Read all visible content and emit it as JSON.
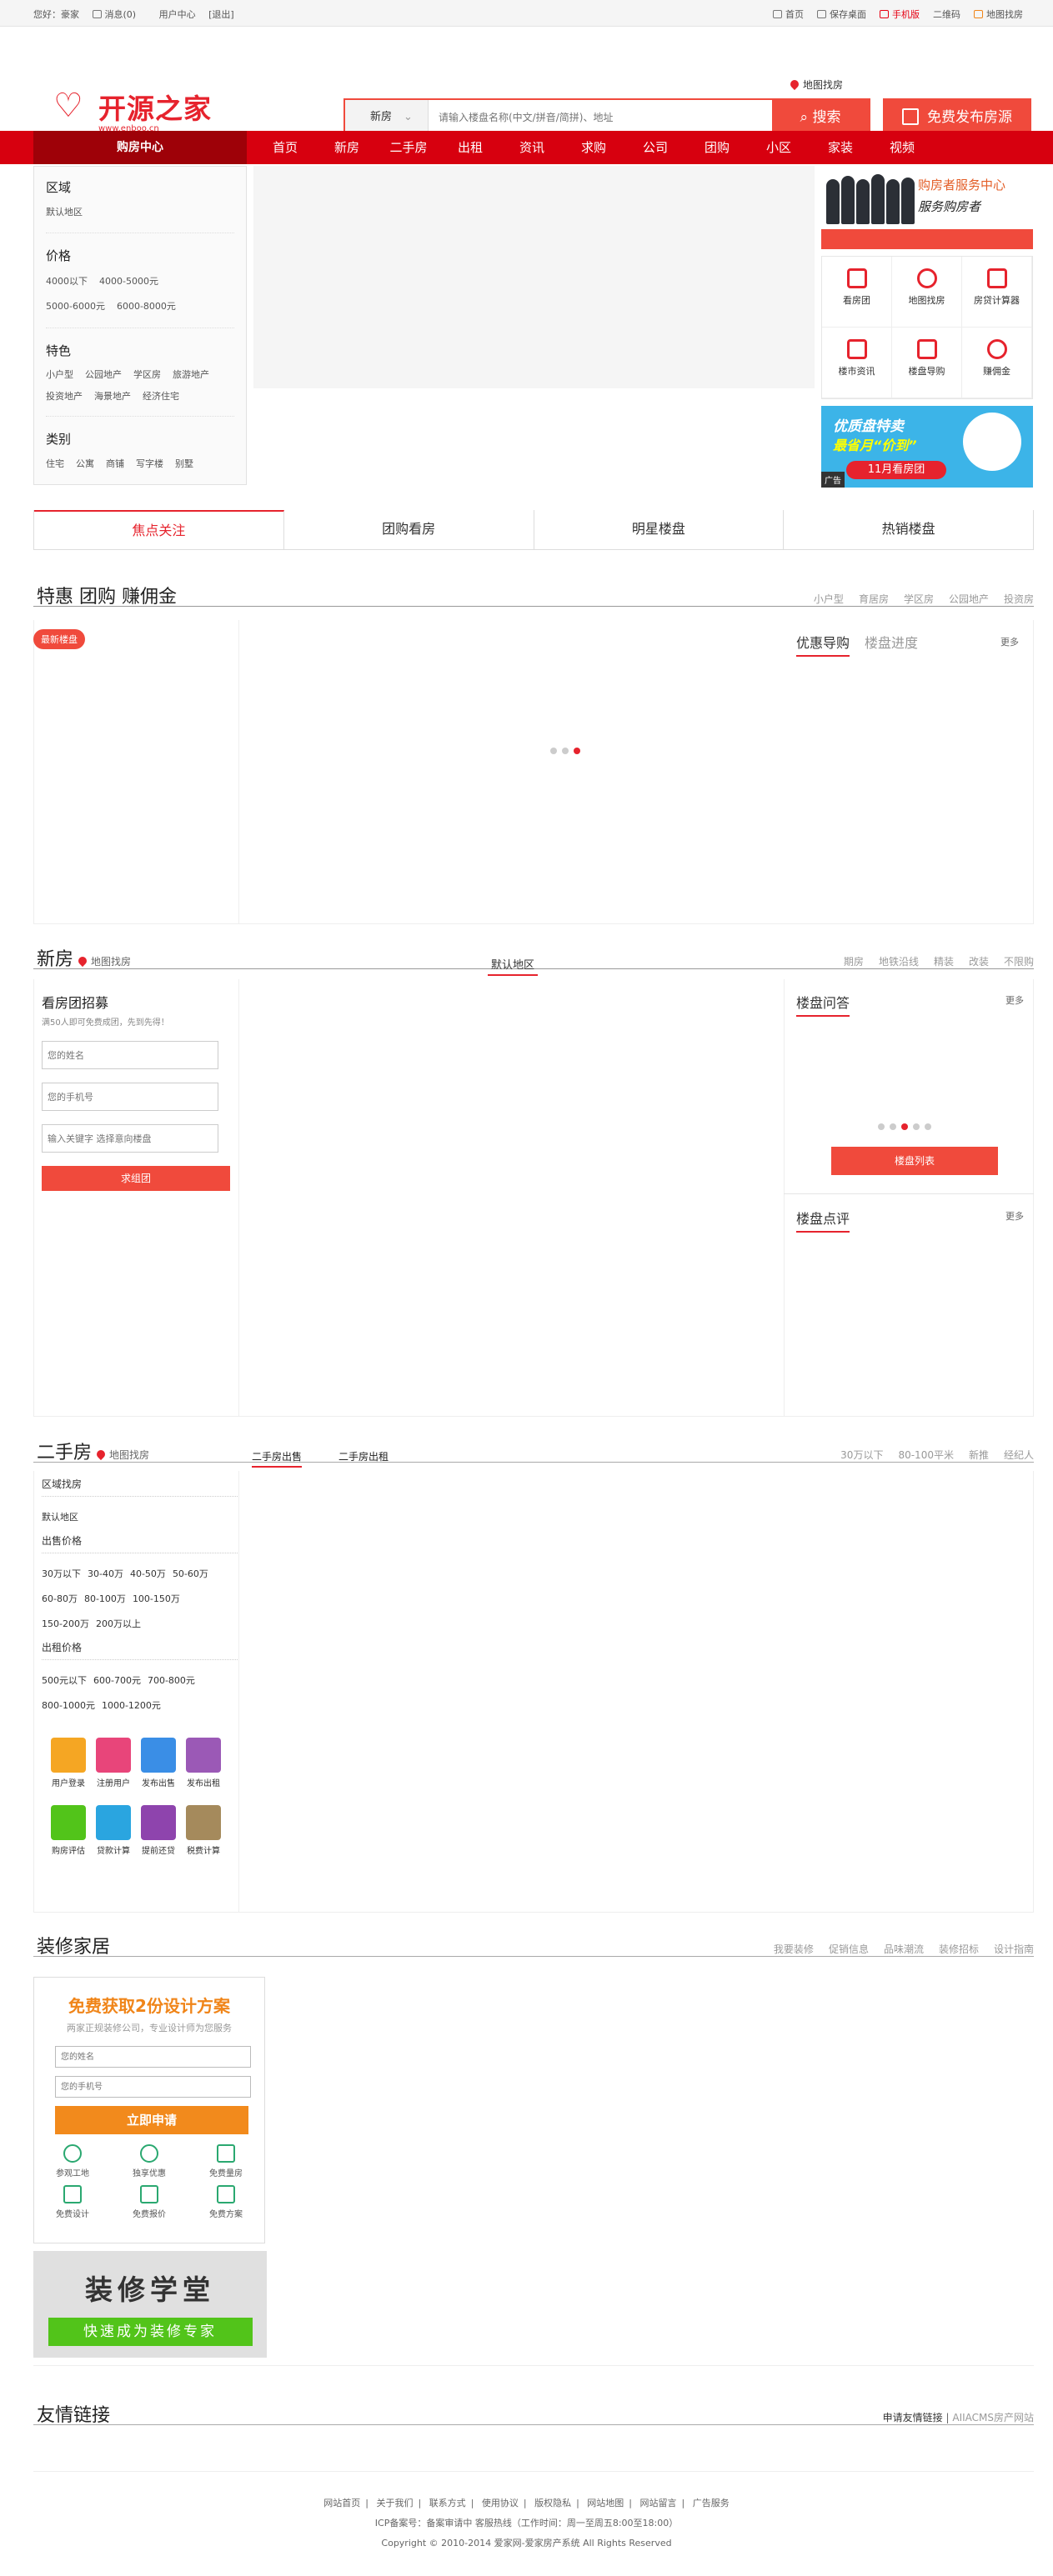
{
  "topbar": {
    "greeting": "您好：豪家",
    "messages": "消息(0)",
    "user_center": "用户中心",
    "logout": "[退出]",
    "right": [
      "首页",
      "保存桌面",
      "手机版",
      "二维码",
      "地图找房"
    ]
  },
  "header": {
    "logo_text": "开源之家",
    "logo_sub": "www.enboo.cn",
    "map_link": "地图找房",
    "search_type": "新房",
    "search_placeholder": "请输入楼盘名称(中文/拼音/简拼)、地址",
    "search_button": "搜索",
    "publish_button": "免费发布房源"
  },
  "nav": {
    "first": "购房中心",
    "items": [
      "首页",
      "新房",
      "二手房",
      "出租",
      "资讯",
      "求购",
      "公司",
      "团购",
      "小区",
      "家装",
      "视频"
    ]
  },
  "filter": {
    "area_title": "区域",
    "area_items": [
      "默认地区"
    ],
    "price_title": "价格",
    "price_row1": [
      "4000以下",
      "4000-5000元"
    ],
    "price_row2": [
      "5000-6000元",
      "6000-8000元"
    ],
    "feature_title": "特色",
    "feature_row1": [
      "小户型",
      "公园地产",
      "学区房",
      "旅游地产"
    ],
    "feature_row2": [
      "投资地产",
      "海景地产",
      "经济住宅"
    ],
    "type_title": "类别",
    "type_row": [
      "住宅",
      "公寓",
      "商铺",
      "写字楼",
      "别墅"
    ]
  },
  "service": {
    "title": "购房者服务中心",
    "subtitle": "服务购房者",
    "grid": [
      "看房团",
      "地图找房",
      "房贷计算器",
      "楼市资讯",
      "楼盘导购",
      "赚佣金"
    ],
    "ad_line1": "优质盘特卖",
    "ad_line2": "最省月“价到”",
    "ad_btn": "11月看房团",
    "ad_tag": "广告"
  },
  "tabs4": [
    "焦点关注",
    "团购看房",
    "明星楼盘",
    "热销楼盘"
  ],
  "special": {
    "title": "特惠 团购 赚佣金",
    "links": [
      "小户型",
      "育居房",
      "学区房",
      "公园地产",
      "投资房"
    ],
    "pill": "最新楼盘",
    "tab_active": "优惠导购",
    "tab_other": "楼盘进度",
    "more": "更多"
  },
  "newhouse": {
    "title": "新房",
    "map": "地图找房",
    "center_tab": "默认地区",
    "links": [
      "期房",
      "地铁沿线",
      "精装",
      "改装",
      "不限购"
    ],
    "form_title": "看房团招募",
    "form_desc": "满50人即可免费成团，先到先得！",
    "ph_name": "您的姓名",
    "ph_phone": "您的手机号",
    "ph_keyword": "输入关键字 选择意向楼盘",
    "form_btn": "求组团",
    "qa_title": "楼盘问答",
    "qa_more": "更多",
    "qa_btn": "楼盘列表",
    "review_title": "楼盘点评",
    "review_more": "更多"
  },
  "ershou": {
    "title": "二手房",
    "map": "地图找房",
    "tab1": "二手房出售",
    "tab2": "二手房出租",
    "links": [
      "30万以下",
      "80-100平米",
      "新推",
      "经纪人"
    ],
    "area_title": "区域找房",
    "area_default": "默认地区",
    "sale_title": "出售价格",
    "sale_row1": [
      "30万以下",
      "30-40万",
      "40-50万",
      "50-60万"
    ],
    "sale_row2": [
      "60-80万",
      "80-100万",
      "100-150万"
    ],
    "sale_row3": [
      "150-200万",
      "200万以上"
    ],
    "rent_title": "出租价格",
    "rent_row1": [
      "500元以下",
      "600-700元",
      "700-800元"
    ],
    "rent_row2": [
      "800-1000元",
      "1000-1200元"
    ],
    "icons": [
      {
        "label": "用户登录",
        "color": "#f5a623"
      },
      {
        "label": "注册用户",
        "color": "#e8457a"
      },
      {
        "label": "发布出售",
        "color": "#3a8ee6"
      },
      {
        "label": "发布出租",
        "color": "#9b59b6"
      },
      {
        "label": "购房评估",
        "color": "#52c41a"
      },
      {
        "label": "贷款计算",
        "color": "#2aa5e0"
      },
      {
        "label": "提前还贷",
        "color": "#8e44ad"
      },
      {
        "label": "税费计算",
        "color": "#a58a5c"
      }
    ]
  },
  "zhuangxiu": {
    "title": "装修家居",
    "links": [
      "我要装修",
      "促销信息",
      "品味潮流",
      "装修招标",
      "设计指南"
    ],
    "box_title": "免费获取2份设计方案",
    "box_desc": "两家正规装修公司，专业设计师为您服务",
    "ph_name": "您的姓名",
    "ph_phone": "您的手机号",
    "btn": "立即申请",
    "grid": [
      "参观工地",
      "独享优惠",
      "免费量房",
      "免费设计",
      "免费报价",
      "免费方案"
    ],
    "school_title": "装修学堂",
    "school_sub": "快速成为装修专家"
  },
  "friends": {
    "title": "友情链接",
    "right_a": "申请友情链接",
    "right_b": "AIIACMS房产网站"
  },
  "footer": {
    "links": [
      "网站首页",
      "关于我们",
      "联系方式",
      "使用协议",
      "版权隐私",
      "网站地图",
      "网站留言",
      "广告服务"
    ],
    "icp": "ICP备案号：备案审请中 客服热线（工作时间：周一至周五8:00至18:00）",
    "copyright": "Copyright © 2010-2014 爱家网-爱家房产系统 All Rights Reserved"
  }
}
